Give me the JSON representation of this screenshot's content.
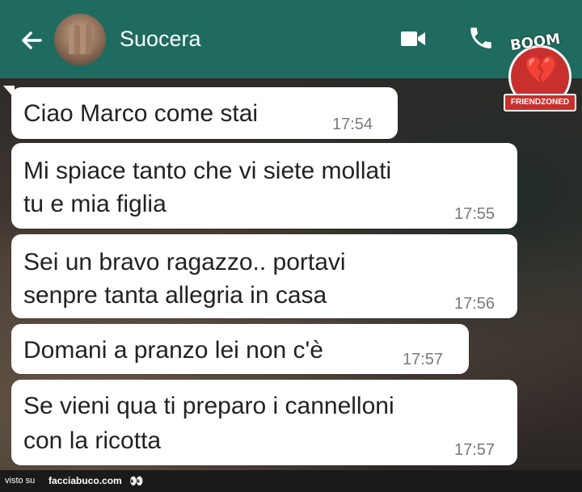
{
  "header": {
    "contact_name": "Suocera",
    "back_icon": "arrow-left-icon",
    "video_icon": "video-camera-icon",
    "call_icon": "phone-icon",
    "color": "#1f6b5f"
  },
  "logo": {
    "top_text": "BOOM",
    "ribbon_text": "FRIENDZONED",
    "color": "#c8302e"
  },
  "messages": [
    {
      "lines": [
        "Ciao Marco come stai"
      ],
      "time": "17:54"
    },
    {
      "lines": [
        "Mi spiace tanto che vi siete mollati",
        "tu e mia figlia"
      ],
      "time": "17:55"
    },
    {
      "lines": [
        "Sei un bravo ragazzo.. portavi",
        "senpre tanta allegria in casa"
      ],
      "time": "17:56"
    },
    {
      "lines": [
        "Domani a pranzo lei non c'è"
      ],
      "time": "17:57"
    },
    {
      "lines": [
        "Se vieni qua ti preparo i cannelloni",
        "con la ricotta"
      ],
      "time": "17:57"
    }
  ],
  "footer": {
    "prefix": "visto su",
    "site": "facciabuco.com",
    "eyes": "👀"
  }
}
